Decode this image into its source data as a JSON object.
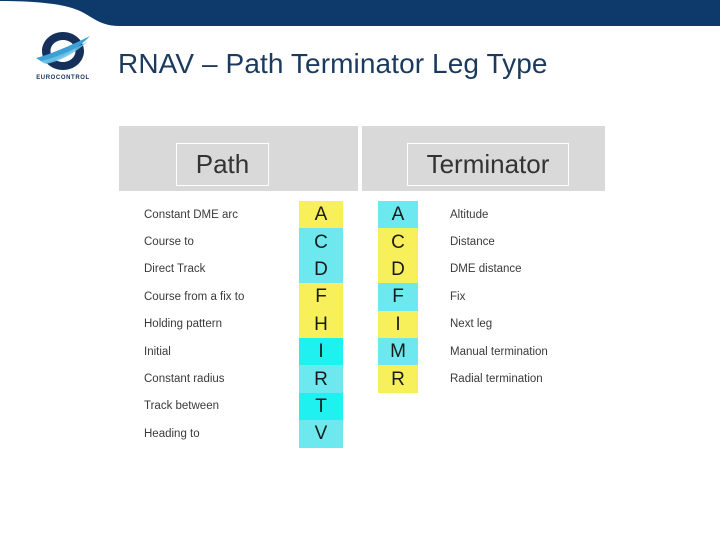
{
  "slide": {
    "title": "RNAV – Path Terminator Leg Type",
    "logo_wordmark": "EUROCONTROL",
    "logo_icon": "eurocontrol-logo-icon",
    "banner_color": "#0d3a6b",
    "title_color": "#1b3a5f"
  },
  "table": {
    "headers": {
      "path": "Path",
      "terminator": "Terminator"
    },
    "header_band_color": "#d9d9d9",
    "colors": {
      "yellow": "#f7f05a",
      "cyan_light": "#6ee8ef",
      "cyan_bright": "#1ff0f0"
    },
    "path_rows": [
      {
        "label": "Constant DME arc",
        "code": "A",
        "color": "#f7f05a"
      },
      {
        "label": "Course to",
        "code": "C",
        "color": "#6ee8ef"
      },
      {
        "label": "Direct Track",
        "code": "D",
        "color": "#6ee8ef"
      },
      {
        "label": "Course from a fix to",
        "code": "F",
        "color": "#f7f05a"
      },
      {
        "label": "Holding pattern",
        "code": "H",
        "color": "#f7f05a"
      },
      {
        "label": "Initial",
        "code": "I",
        "color": "#1ff0f0"
      },
      {
        "label": "Constant radius",
        "code": "R",
        "color": "#6ee8ef"
      },
      {
        "label": "Track between",
        "code": "T",
        "color": "#1ff0f0"
      },
      {
        "label": "Heading to",
        "code": "V",
        "color": "#6ee8ef"
      }
    ],
    "terminator_rows": [
      {
        "code": "A",
        "color": "#6ee8ef",
        "label": "Altitude"
      },
      {
        "code": "C",
        "color": "#f7f05a",
        "label": "Distance"
      },
      {
        "code": "D",
        "color": "#f7f05a",
        "label": "DME distance"
      },
      {
        "code": "F",
        "color": "#6ee8ef",
        "label": "Fix"
      },
      {
        "code": "I",
        "color": "#f7f05a",
        "label": "Next leg"
      },
      {
        "code": "M",
        "color": "#6ee8ef",
        "label": "Manual termination"
      },
      {
        "code": "R",
        "color": "#f7f05a",
        "label": "Radial termination"
      }
    ]
  }
}
